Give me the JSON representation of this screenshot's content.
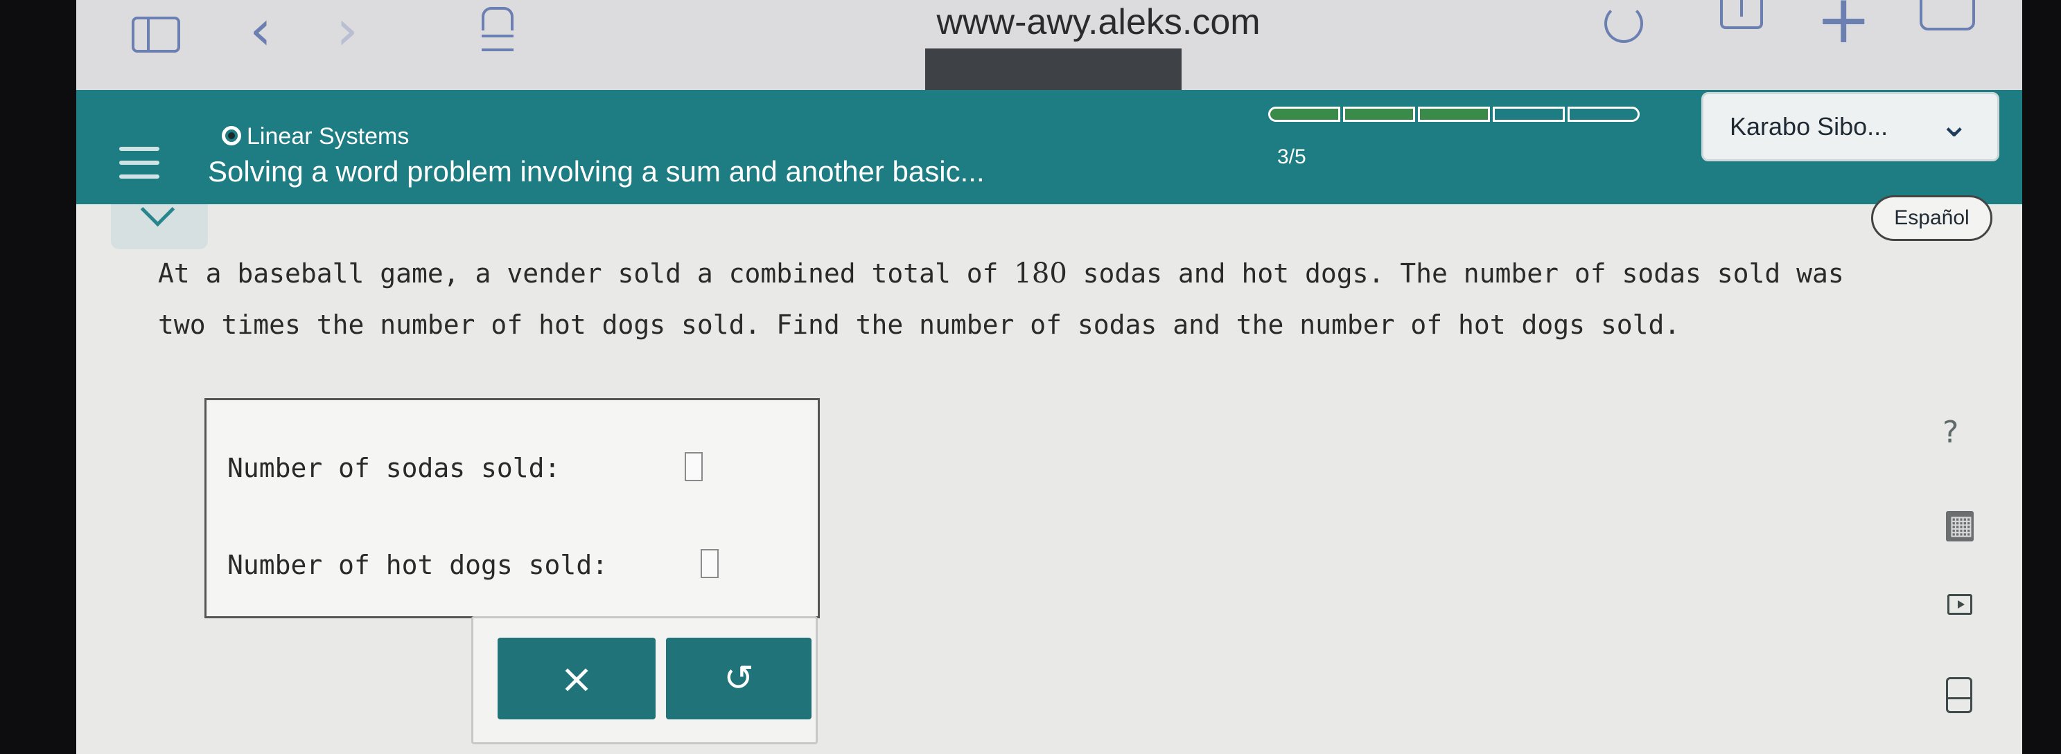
{
  "browser": {
    "url": "www-awy.aleks.com",
    "icons": [
      "sidebar-icon",
      "back-icon",
      "forward-icon",
      "reader-icon",
      "reload-icon",
      "share-icon",
      "new-tab-icon",
      "tabs-icon"
    ]
  },
  "header": {
    "topic": "Linear Systems",
    "title": "Solving a word problem involving a sum and another basic...",
    "progress_text": "3/5",
    "progress_completed": 3,
    "progress_total": 5,
    "user_name": "Karabo Sibo...",
    "language_button": "Español",
    "colors": {
      "bar": "#1d7d82",
      "progress_done": "#3a8a4a",
      "buttons": "#1f7379"
    }
  },
  "question": {
    "text_before": "At a baseball game, a vender sold a combined total of ",
    "number": "180",
    "text_after": " sodas and hot dogs. The number of sodas sold was two times the number of hot dogs sold. Find the number of sodas and the number of hot dogs sold."
  },
  "answers": [
    {
      "label": "Number of sodas sold:",
      "value": ""
    },
    {
      "label": "Number of hot dogs sold:",
      "value": ""
    }
  ],
  "buttons": {
    "clear": "×",
    "undo": "↺"
  },
  "side_tools": {
    "help": "?"
  }
}
